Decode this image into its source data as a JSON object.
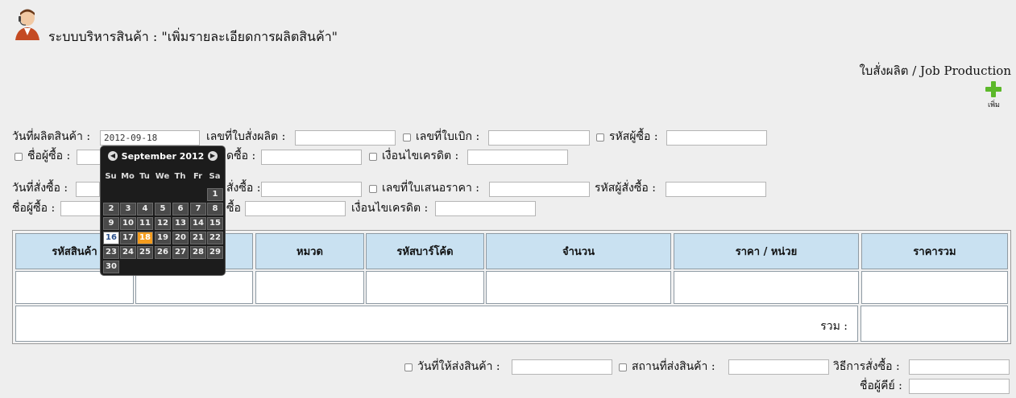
{
  "header": {
    "title": "ระบบบริหารสินค้า : \"เพิ่มรายละเอียดการผลิตสินค้า\"",
    "job_production": "ใบสั่งผลิต / Job Production",
    "add_label": "เพิ่ม"
  },
  "form1": {
    "production_date_label": "วันที่ผลิตสินค้า :",
    "production_date_value": "2012-09-18",
    "job_order_no_label": "เลขที่ใบสั่งผลิต :",
    "requisition_no_label": "เลขที่ใบเบิก :",
    "buyer_code_label": "รหัสผู้ซื้อ :",
    "buyer_name_label": "ชื่อผู้ซื้อ :",
    "buyer_name_partial": "ดซื้อ :",
    "credit_terms_label": "เงื่อนไขเครดิต :"
  },
  "form2": {
    "order_date_label": "วันที่สั่งซื้อ :",
    "order_no_partial": "สั่งซื้อ :",
    "quotation_no_label": "เลขที่ใบเสนอราคา :",
    "orderer_code_label": "รหัสผู้สั่งซื้อ :",
    "buyer_name_label": "ชื่อผู้ซื้อ :",
    "partial_label": "ซื้อ :",
    "credit_terms_label": "เงื่อนไขเครดิต :"
  },
  "table": {
    "columns": [
      "รหัสสินค้า",
      "",
      "หมวด",
      "รหัสบาร์โค้ด",
      "จำนวน",
      "ราคา / หน่วย",
      "ราคารวม"
    ],
    "total_label": "รวม :"
  },
  "footer": {
    "delivery_date_label": "วันที่ให้ส่งสินค้า :",
    "delivery_place_label": "สถานที่ส่งสินค้า :",
    "order_method_label": "วิธีการสั่งซื้อ :",
    "keyer_label": "ชื่อผู้คีย์ :"
  },
  "calendar": {
    "month_label": "September 2012",
    "weekdays": [
      "Su",
      "Mo",
      "Tu",
      "We",
      "Th",
      "Fr",
      "Sa"
    ],
    "first_weekday_index": 6,
    "days_in_month": 30,
    "today": 16,
    "selected": 18,
    "prev_icon": "chevron-left-icon",
    "next_icon": "chevron-right-icon"
  },
  "colors": {
    "header_bg": "#c9e1f1",
    "selected_day": "#f39c1e",
    "add_icon": "#5cb82a"
  }
}
